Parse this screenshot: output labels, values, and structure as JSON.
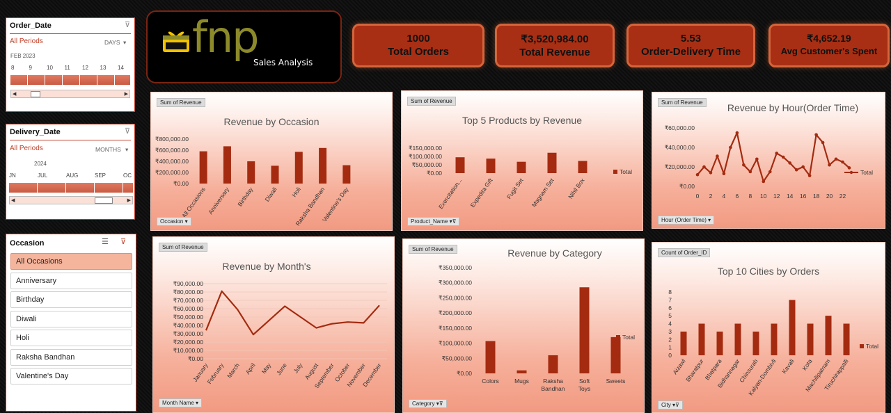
{
  "slicers": {
    "order_date": {
      "title": "Order_Date",
      "period": "All Periods",
      "granularity": "DAYS",
      "year_label": "FEB 2023",
      "ticks": [
        "8",
        "9",
        "10",
        "11",
        "12",
        "13",
        "14"
      ]
    },
    "delivery_date": {
      "title": "Delivery_Date",
      "period": "All Periods",
      "granularity": "MONTHS",
      "year_label": "2024",
      "ticks": [
        "JN",
        "JUL",
        "AUG",
        "SEP",
        "OC"
      ]
    },
    "occasion": {
      "title": "Occasion",
      "items": [
        "All Occasions",
        "Anniversary",
        "Birthday",
        "Diwali",
        "Holi",
        "Raksha Bandhan",
        "Valentine's Day"
      ],
      "selected": "All Occasions"
    }
  },
  "logo": {
    "brand": "fnp",
    "subtitle": "Sales Analysis"
  },
  "kpis": [
    {
      "value": "1000",
      "label": "Total Orders"
    },
    {
      "value": "₹3,520,984.00",
      "label": "Total Revenue"
    },
    {
      "value": "5.53",
      "label": "Order-Delivery Time"
    },
    {
      "value": "₹4,652.19",
      "label": "Avg Customer's Spent"
    }
  ],
  "colors": {
    "accent": "#a82f14",
    "bar": "#a42b10",
    "card_bottom": "#f29a82",
    "kpi_border": "#d4653c"
  },
  "charts": [
    {
      "tag": "Sum of Revenue",
      "field": "Occasion"
    },
    {
      "tag": "Sum of Revenue",
      "field": "Product_Name"
    },
    {
      "tag": "Sum of Revenue",
      "field": "Hour (Order Time)"
    },
    {
      "tag": "Sum of Revenue",
      "field": "Month Name"
    },
    {
      "tag": "Sum of Revenue",
      "field": "Category"
    },
    {
      "tag": "Count of Order_ID",
      "field": "City"
    }
  ],
  "chart_data": [
    {
      "type": "bar",
      "title": "Revenue by Occasion",
      "categories": [
        "All Occasions",
        "Anniversary",
        "Birthday",
        "Diwali",
        "Holi",
        "Raksha Bandhan",
        "Valentine's Day"
      ],
      "values": [
        580000,
        670000,
        400000,
        320000,
        570000,
        640000,
        330000
      ],
      "yticks": [
        "₹0.00",
        "₹200,000.00",
        "₹400,000.00",
        "₹600,000.00",
        "₹800,000.00"
      ],
      "ylim": [
        0,
        800000
      ]
    },
    {
      "type": "bar",
      "title": "Top 5 Products by Revenue",
      "categories": [
        "Exercitation...",
        "Expedita Gift",
        "Fugit Set",
        "Magnam Set",
        "Nihil Box"
      ],
      "values": [
        95000,
        87000,
        68000,
        122000,
        73000
      ],
      "yticks": [
        "₹0.00",
        "₹50,000.00",
        "₹100,000.00",
        "₹150,000.00"
      ],
      "ylim": [
        0,
        150000
      ],
      "legend": "Total"
    },
    {
      "type": "line",
      "title": "Revenue by Hour(Order Time)",
      "x": [
        0,
        1,
        2,
        3,
        4,
        5,
        6,
        7,
        8,
        9,
        10,
        11,
        12,
        13,
        14,
        15,
        16,
        17,
        18,
        19,
        20,
        21,
        22,
        23
      ],
      "values": [
        12000,
        20000,
        14000,
        31000,
        13000,
        40000,
        55000,
        22000,
        15000,
        28000,
        5000,
        15000,
        34000,
        30000,
        24000,
        17000,
        20000,
        11000,
        53000,
        45000,
        22000,
        28000,
        25000,
        19000
      ],
      "xticks": [
        "0",
        "2",
        "4",
        "6",
        "8",
        "10",
        "12",
        "14",
        "16",
        "18",
        "20",
        "22"
      ],
      "yticks": [
        "₹0.00",
        "₹20,000.00",
        "₹40,000.00",
        "₹60,000.00"
      ],
      "ylim": [
        0,
        60000
      ],
      "legend": "Total"
    },
    {
      "type": "line",
      "title": "Revenue by Month's",
      "categories": [
        "January",
        "February",
        "March",
        "April",
        "May",
        "June",
        "July",
        "August",
        "September",
        "October",
        "November",
        "December"
      ],
      "values": [
        34000,
        81000,
        59000,
        29000,
        46000,
        63000,
        50000,
        37000,
        42000,
        44000,
        43000,
        64000
      ],
      "yticks": [
        "₹0.00",
        "₹10,000.00",
        "₹20,000.00",
        "₹30,000.00",
        "₹40,000.00",
        "₹50,000.00",
        "₹60,000.00",
        "₹70,000.00",
        "₹80,000.00",
        "₹90,000.00"
      ],
      "ylim": [
        0,
        90000
      ]
    },
    {
      "type": "bar",
      "title": "Revenue by Category",
      "categories": [
        "Colors",
        "Mugs",
        "Raksha Bandhan",
        "Soft Toys",
        "Sweets"
      ],
      "values": [
        107000,
        10000,
        60000,
        285000,
        120000
      ],
      "yticks": [
        "₹0.00",
        "₹50,000.00",
        "₹100,000.00",
        "₹150,000.00",
        "₹200,000.00",
        "₹250,000.00",
        "₹300,000.00",
        "₹350,000.00"
      ],
      "ylim": [
        0,
        350000
      ],
      "legend": "Total"
    },
    {
      "type": "bar",
      "title": "Top 10 Cities by Orders",
      "categories": [
        "Aizawl",
        "Bharatpur",
        "Bhatpara",
        "Bidhannagar",
        "Chinsurah",
        "Kalyan-Dombivli",
        "Kavali",
        "Kota",
        "Machilipatnam",
        "Tiruchirappalli"
      ],
      "values": [
        3,
        4,
        3,
        4,
        3,
        4,
        7,
        4,
        5,
        4
      ],
      "yticks": [
        "0",
        "1",
        "2",
        "3",
        "4",
        "5",
        "6",
        "7",
        "8"
      ],
      "ylim": [
        0,
        8
      ],
      "legend": "Total"
    }
  ]
}
